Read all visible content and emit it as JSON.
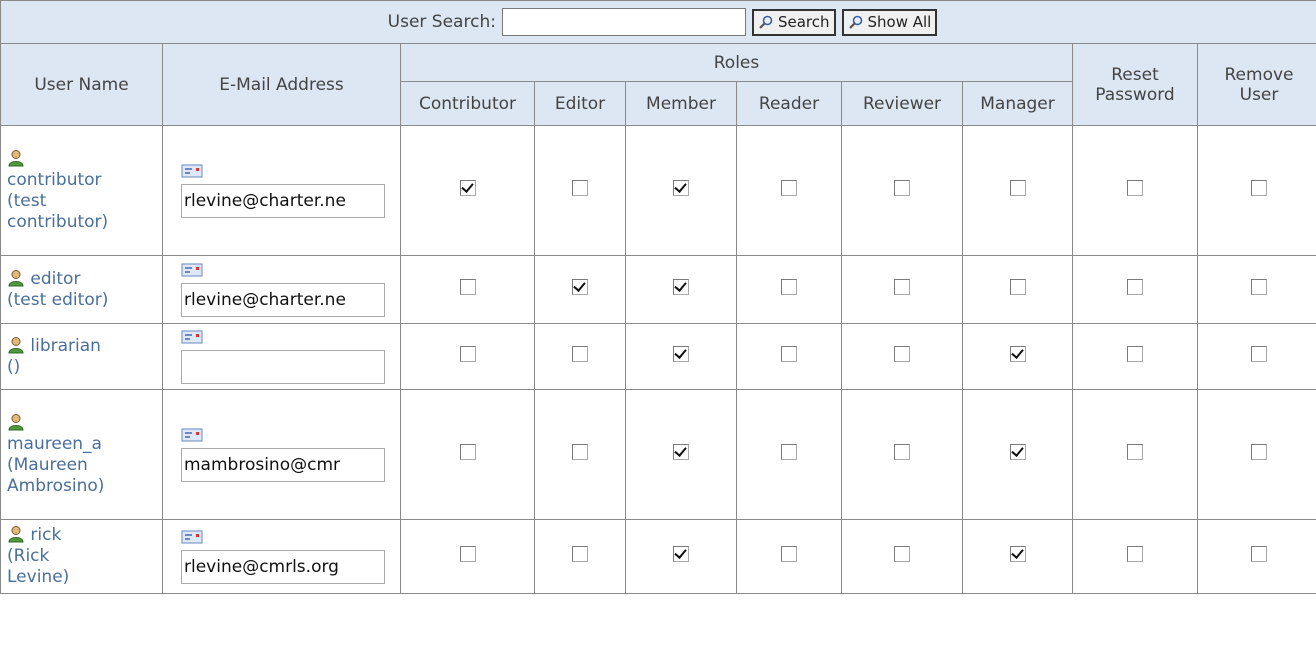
{
  "search": {
    "label": "User Search:",
    "value": "",
    "search_button": "Search",
    "show_all_button": "Show All"
  },
  "headers": {
    "user_name": "User Name",
    "email": "E-Mail Address",
    "roles": "Roles",
    "reset_line1": "Reset",
    "reset_line2": "Password",
    "remove_line1": "Remove",
    "remove_line2": "User",
    "role_names": [
      "Contributor",
      "Editor",
      "Member",
      "Reader",
      "Reviewer",
      "Manager"
    ]
  },
  "users": [
    {
      "id": "contributor",
      "name_lines": [
        "contributor",
        "(test",
        "contributor)"
      ],
      "icon_own_line": true,
      "email": "rlevine@charter.ne",
      "roles": [
        true,
        false,
        true,
        false,
        false,
        false
      ],
      "reset": false,
      "remove": false
    },
    {
      "id": "editor",
      "name_lines": [
        "editor",
        "(test editor)"
      ],
      "icon_own_line": false,
      "email": "rlevine@charter.ne",
      "roles": [
        false,
        true,
        true,
        false,
        false,
        false
      ],
      "reset": false,
      "remove": false
    },
    {
      "id": "librarian",
      "name_lines": [
        "librarian",
        "()"
      ],
      "icon_own_line": false,
      "email": "",
      "roles": [
        false,
        false,
        true,
        false,
        false,
        true
      ],
      "reset": false,
      "remove": false
    },
    {
      "id": "maureen_a",
      "name_lines": [
        "maureen_a",
        "(Maureen",
        "Ambrosino)"
      ],
      "icon_own_line": true,
      "email": "mambrosino@cmr",
      "roles": [
        false,
        false,
        true,
        false,
        false,
        true
      ],
      "reset": false,
      "remove": false
    },
    {
      "id": "rick",
      "name_lines": [
        "rick",
        "(Rick",
        "Levine)"
      ],
      "icon_own_line": false,
      "email": "rlevine@cmrls.org",
      "roles": [
        false,
        false,
        true,
        false,
        false,
        true
      ],
      "reset": false,
      "remove": false
    }
  ],
  "colors": {
    "header_bg": "#dde6f3",
    "link": "#4a6f9a",
    "border": "#8a8a8a"
  },
  "icons": {
    "search": "magnifier-icon",
    "user": "user-icon",
    "email": "email-card-icon"
  }
}
